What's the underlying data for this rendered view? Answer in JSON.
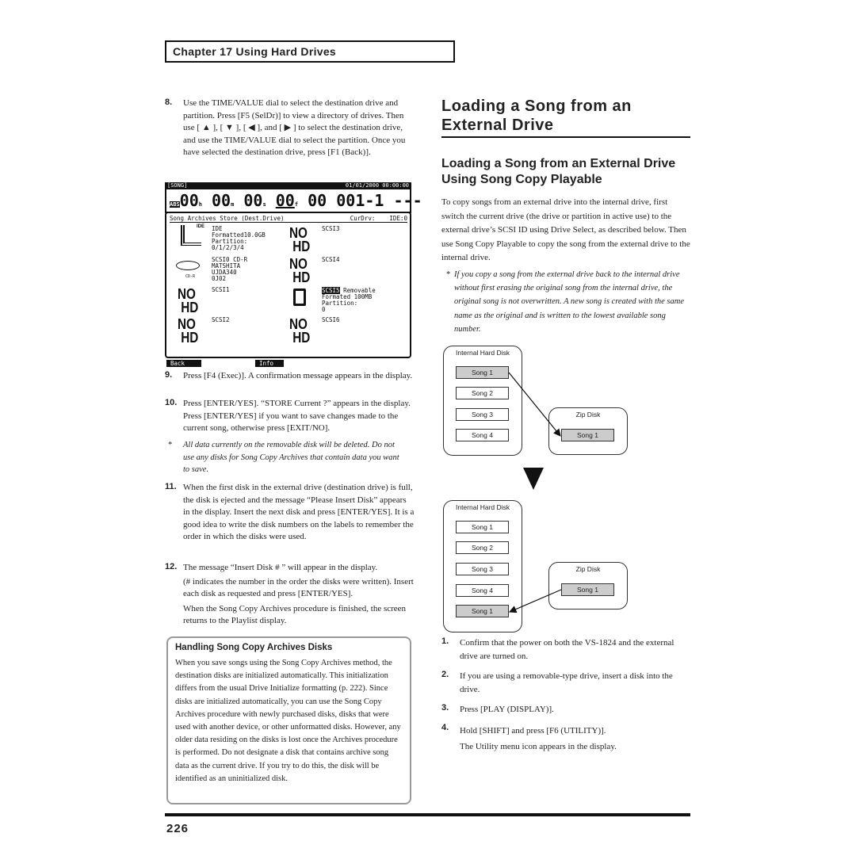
{
  "chapter": "Chapter 17 Using Hard Drives",
  "left": {
    "step8": {
      "num": "8.",
      "text": "Use the TIME/VALUE dial to select the destination drive and partition. Press [F5 (SelDr)] to view a directory of drives. Then use [ ▲ ], [ ▼ ], [ ◀ ], and [ ▶ ] to select the destination drive, and use the TIME/VALUE dial to select the partition. Once you have selected the destination drive, press [F1 (Back)]."
    },
    "lcd": {
      "mode": "[SONG]",
      "datetime": "01/01/2000 00:00:00",
      "abs": "ABS",
      "h": "00",
      "m": "00",
      "s": "00",
      "f": "00",
      "sub": "00",
      "meas": "001-1",
      "beat": "---",
      "title": "Song Archives Store (Dest.Drive)",
      "curdrv_label": "CurDrv:",
      "curdrv": "IDE:0",
      "drives": [
        {
          "text": "IDE\nFormatted10.0GB\nPartition:\n0/1/2/3/4",
          "icon": "ide-drive-icon"
        },
        {
          "text": "SCSI0 CD-R\nMATSHITA\nUJDA340\n0J02",
          "icon": "cd-r-icon",
          "icon_label": "CD-R"
        },
        {
          "text": "SCSI1",
          "icon": "no-hd"
        },
        {
          "text": "SCSI2",
          "icon": "no-hd"
        },
        {
          "text": "SCSI3",
          "icon": "no-hd"
        },
        {
          "text": "SCSI4",
          "icon": "no-hd"
        },
        {
          "id": "SCSI5",
          "text": " Removable\nFormated 100MB\nPartition:\n0",
          "icon": "removable-disk-hand-icon"
        },
        {
          "text": "SCSI6",
          "icon": "no-hd"
        }
      ],
      "no": "NO",
      "hd": "HD",
      "ide_label": "IDE",
      "f1": "Back",
      "f4": "Info"
    },
    "step9": {
      "num": "9.",
      "text": "Press [F4 (Exec)]. A confirmation message appears in the display."
    },
    "step10": {
      "num": "10.",
      "text": "Press [ENTER/YES]. “STORE Current ?” appears in the display. Press [ENTER/YES] if you want to save changes made to the current song, otherwise press [EXIT/NO]."
    },
    "note1": {
      "mark": "*",
      "text": "All data currently on the removable disk will be deleted. Do not use any disks for Song Copy Archives that contain data you want to save."
    },
    "step11": {
      "num": "11.",
      "text": "When the first disk in the external drive (destination drive) is full, the disk is ejected and the message “Please Insert Disk” appears in the display. Insert the next disk and press [ENTER/YES]. It is a good idea to write the disk numbers on the labels to remember the order in which the disks were used."
    },
    "step12": {
      "num": "12.",
      "text": "The message “Insert Disk # ” will appear in the display.",
      "text2": "(# indicates the number in the order the disks were written). Insert each disk as requested and press [ENTER/YES].",
      "text3": "When the Song Copy Archives procedure is finished, the screen returns to the Playlist display."
    },
    "box": {
      "title": "Handling Song Copy Archives Disks",
      "text": "When you save songs using the Song Copy Archives method, the destination disks are initialized automatically. This initialization differs from the usual Drive Initialize formatting (p. 222). Since disks are initialized automatically, you can use the Song Copy Archives procedure with newly purchased disks, disks that were used with another device, or other unformatted disks. However, any older data residing on the disks is lost once the Archives procedure is performed. Do not designate a disk that contains archive song data as the current drive. If you try to do this, the disk will be identified as an uninitialized disk."
    }
  },
  "right": {
    "title": "Loading a Song from an External Drive",
    "subtitle": "Loading a Song from an External Drive Using Song Copy Playable",
    "intro": "To copy songs from an external drive into the internal drive, first switch the current drive (the drive or partition in active use) to the external drive’s SCSI ID using Drive Select, as described below. Then use Song Copy Playable to copy the song from the external drive to the internal drive.",
    "note": {
      "mark": "*",
      "text": "If you copy a song from the external drive back to the internal drive without first erasing the original song from the internal drive, the original song is not overwritten. A new song is created with the same name as the original and is written to the lowest available song number."
    },
    "diagram": {
      "internal_label": "Internal Hard Disk",
      "zip_label": "Zip Disk",
      "before": {
        "internal": [
          "Song 1",
          "Song 2",
          "Song 3",
          "Song 4"
        ],
        "zip": [
          "Song 1"
        ]
      },
      "after": {
        "internal": [
          "Song 1",
          "Song 2",
          "Song 3",
          "Song 4",
          "Song 1"
        ],
        "zip": [
          "Song 1"
        ]
      }
    },
    "steps": [
      {
        "num": "1.",
        "text": "Confirm that the power on both the VS-1824 and the external drive are turned on."
      },
      {
        "num": "2.",
        "text": "If you are using a removable-type drive, insert a disk into the drive."
      },
      {
        "num": "3.",
        "text": "Press [PLAY (DISPLAY)]."
      },
      {
        "num": "4.",
        "text": "Hold [SHIFT] and press [F6 (UTILITY)].",
        "text2": "The Utility menu icon appears in the display."
      }
    ]
  },
  "page_number": "226"
}
